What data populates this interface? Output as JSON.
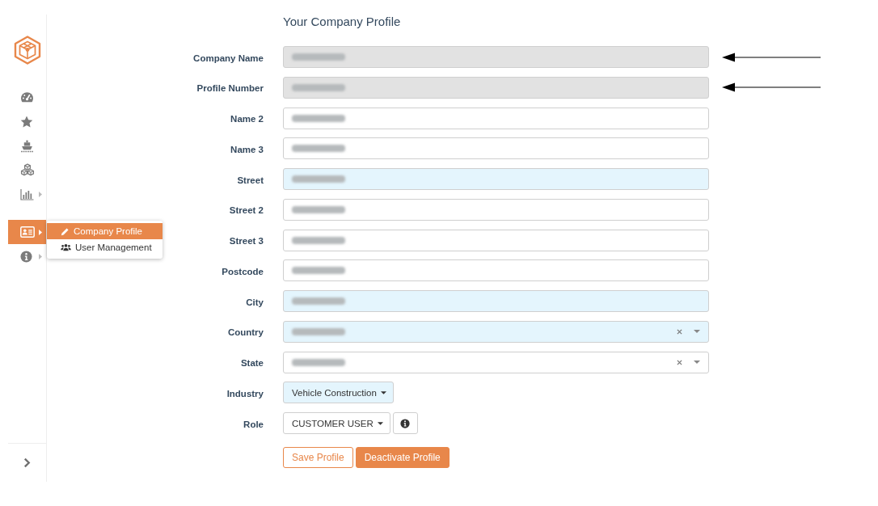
{
  "sidebar": {
    "groups": [
      {
        "items": [
          {
            "selected": false,
            "has_submenu": false,
            "expanded": false
          },
          {
            "selected": false,
            "has_submenu": false,
            "expanded": false
          },
          {
            "selected": false,
            "has_submenu": false,
            "expanded": false
          },
          {
            "selected": false,
            "has_submenu": false,
            "expanded": false
          },
          {
            "selected": false,
            "has_submenu": true,
            "expanded": false
          }
        ]
      },
      {
        "items": [
          {
            "selected": true,
            "has_submenu": true,
            "expanded": true,
            "submenu": [
              {
                "label": "Company Profile",
                "selected": true
              },
              {
                "label": "User Management",
                "selected": false
              }
            ]
          },
          {
            "selected": false,
            "has_submenu": true,
            "expanded": false
          }
        ]
      }
    ]
  },
  "profile_form": {
    "title": "Your Company Profile",
    "fields": [
      {
        "label": "Company Name",
        "kind": "text",
        "disabled": true,
        "highlighted": false,
        "value_redacted": true,
        "clearable": false,
        "info_button": false,
        "marked_by_arrow": true
      },
      {
        "label": "Profile Number",
        "kind": "text",
        "disabled": true,
        "highlighted": false,
        "value_redacted": true,
        "clearable": false,
        "info_button": false,
        "marked_by_arrow": true
      },
      {
        "label": "Name 2",
        "kind": "text",
        "disabled": false,
        "highlighted": false,
        "value_redacted": true,
        "clearable": false,
        "info_button": false,
        "marked_by_arrow": false
      },
      {
        "label": "Name 3",
        "kind": "text",
        "disabled": false,
        "highlighted": false,
        "value_redacted": true,
        "clearable": false,
        "info_button": false,
        "marked_by_arrow": false
      },
      {
        "label": "Street",
        "kind": "text",
        "disabled": false,
        "highlighted": true,
        "value_redacted": true,
        "clearable": false,
        "info_button": false,
        "marked_by_arrow": false
      },
      {
        "label": "Street 2",
        "kind": "text",
        "disabled": false,
        "highlighted": false,
        "value_redacted": true,
        "clearable": false,
        "info_button": false,
        "marked_by_arrow": false
      },
      {
        "label": "Street 3",
        "kind": "text",
        "disabled": false,
        "highlighted": false,
        "value_redacted": true,
        "clearable": false,
        "info_button": false,
        "marked_by_arrow": false
      },
      {
        "label": "Postcode",
        "kind": "text",
        "disabled": false,
        "highlighted": false,
        "value_redacted": true,
        "clearable": false,
        "info_button": false,
        "marked_by_arrow": false
      },
      {
        "label": "City",
        "kind": "text",
        "disabled": false,
        "highlighted": true,
        "value_redacted": true,
        "clearable": false,
        "info_button": false,
        "marked_by_arrow": false
      },
      {
        "label": "Country",
        "kind": "select",
        "disabled": false,
        "highlighted": true,
        "value_redacted": true,
        "clearable": true,
        "info_button": false,
        "marked_by_arrow": false
      },
      {
        "label": "State",
        "kind": "select",
        "disabled": false,
        "highlighted": false,
        "value_redacted": true,
        "clearable": true,
        "info_button": false,
        "marked_by_arrow": false
      },
      {
        "label": "Industry",
        "kind": "dropdown",
        "value": "Vehicle Construction",
        "disabled": false,
        "highlighted": true,
        "value_redacted": false,
        "clearable": false,
        "info_button": false,
        "marked_by_arrow": false
      },
      {
        "label": "Role",
        "kind": "dropdown",
        "value": "CUSTOMER USER",
        "disabled": false,
        "highlighted": false,
        "value_redacted": false,
        "clearable": false,
        "info_button": true,
        "marked_by_arrow": false
      }
    ],
    "buttons": [
      {
        "label": "Save Profile",
        "kind": "outline"
      },
      {
        "label": "Deactivate Profile",
        "kind": "primary"
      }
    ]
  }
}
